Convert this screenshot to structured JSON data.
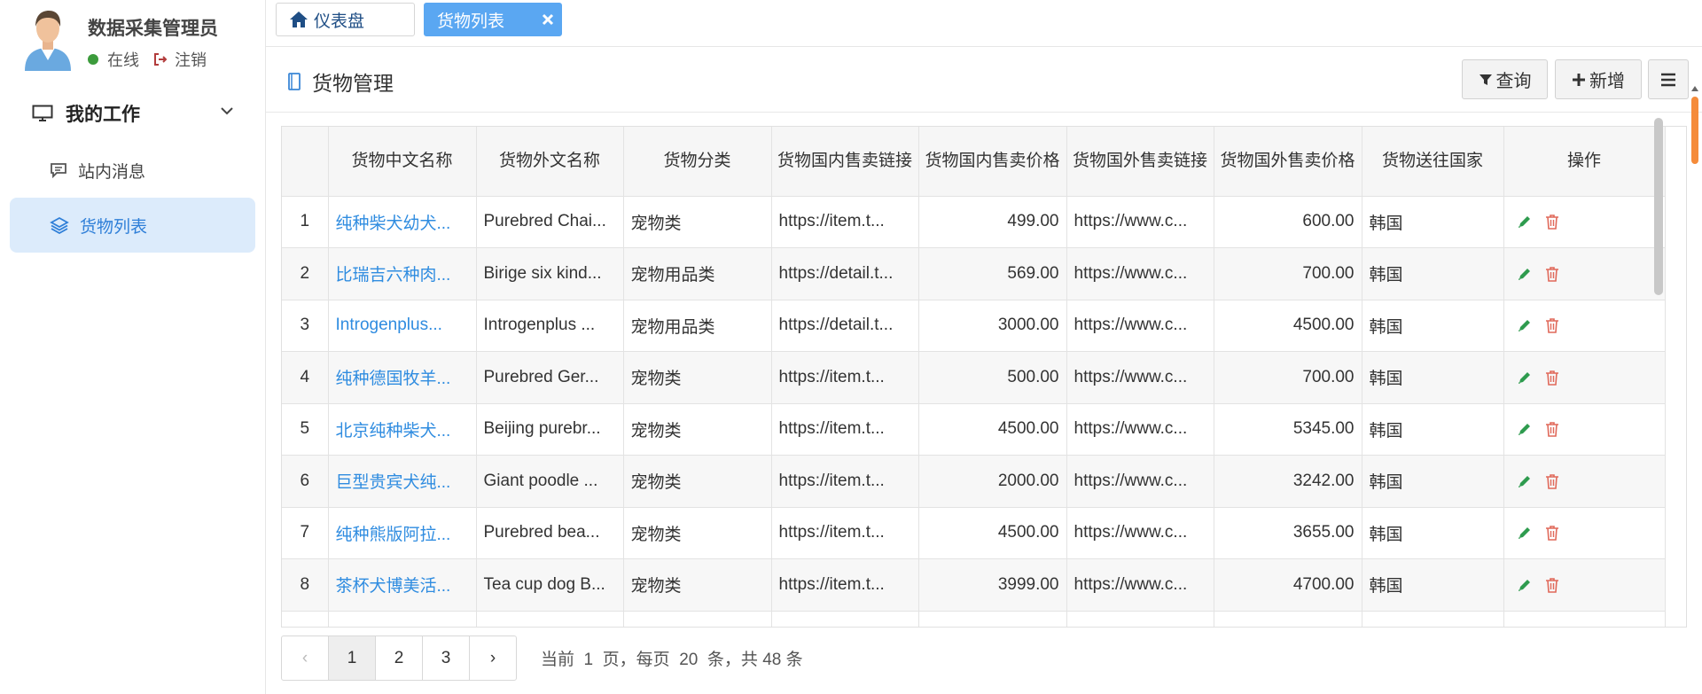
{
  "user": {
    "name": "数据采集管理员",
    "status": "在线",
    "logout": "注销"
  },
  "menu": {
    "header": "我的工作",
    "items": [
      {
        "label": "站内消息",
        "icon": "comment-icon",
        "active": false
      },
      {
        "label": "货物列表",
        "icon": "layers-icon",
        "active": true
      }
    ]
  },
  "tabs": [
    {
      "label": "仪表盘",
      "icon": "home-icon",
      "active": false
    },
    {
      "label": "货物列表",
      "active": true,
      "closable": true
    }
  ],
  "panel": {
    "title": "货物管理",
    "buttons": {
      "query": "查询",
      "add": "新增"
    }
  },
  "table": {
    "columns": [
      "",
      "货物中文名称",
      "货物外文名称",
      "货物分类",
      "货物国内售卖链接",
      "货物国内售卖价格",
      "货物国外售卖链接",
      "货物国外售卖价格",
      "货物送往国家",
      "操作"
    ],
    "rows": [
      [
        "1",
        "纯种柴犬幼犬...",
        "Purebred Chai...",
        "宠物类",
        "https://item.t...",
        "499.00",
        "https://www.c...",
        "600.00",
        "韩国"
      ],
      [
        "2",
        "比瑞吉六种肉...",
        "Birige six kind...",
        "宠物用品类",
        "https://detail.t...",
        "569.00",
        "https://www.c...",
        "700.00",
        "韩国"
      ],
      [
        "3",
        "Introgenplus...",
        "Introgenplus ...",
        "宠物用品类",
        "https://detail.t...",
        "3000.00",
        "https://www.c...",
        "4500.00",
        "韩国"
      ],
      [
        "4",
        "纯种德国牧羊...",
        "Purebred Ger...",
        "宠物类",
        "https://item.t...",
        "500.00",
        "https://www.c...",
        "700.00",
        "韩国"
      ],
      [
        "5",
        "北京纯种柴犬...",
        "Beijing purebr...",
        "宠物类",
        "https://item.t...",
        "4500.00",
        "https://www.c...",
        "5345.00",
        "韩国"
      ],
      [
        "6",
        "巨型贵宾犬纯...",
        "Giant poodle ...",
        "宠物类",
        "https://item.t...",
        "2000.00",
        "https://www.c...",
        "3242.00",
        "韩国"
      ],
      [
        "7",
        "纯种熊版阿拉...",
        "Purebred bea...",
        "宠物类",
        "https://item.t...",
        "4500.00",
        "https://www.c...",
        "3655.00",
        "韩国"
      ],
      [
        "8",
        "茶杯犬博美活...",
        "Tea cup dog B...",
        "宠物类",
        "https://item.t...",
        "3999.00",
        "https://www.c...",
        "4700.00",
        "韩国"
      ],
      [
        "",
        "",
        "",
        "",
        "",
        "",
        "",
        "",
        ""
      ]
    ]
  },
  "pagination": {
    "prev": "‹",
    "next": "›",
    "pages": [
      "1",
      "2",
      "3"
    ],
    "current": "1",
    "info": "当前  1  页，每页  20  条，共 48 条"
  },
  "colors": {
    "accent": "#5aa7f2",
    "link": "#2f8ce0",
    "edit": "#2e9b4e",
    "delete": "#e0695a",
    "online": "#3c9b3c"
  }
}
